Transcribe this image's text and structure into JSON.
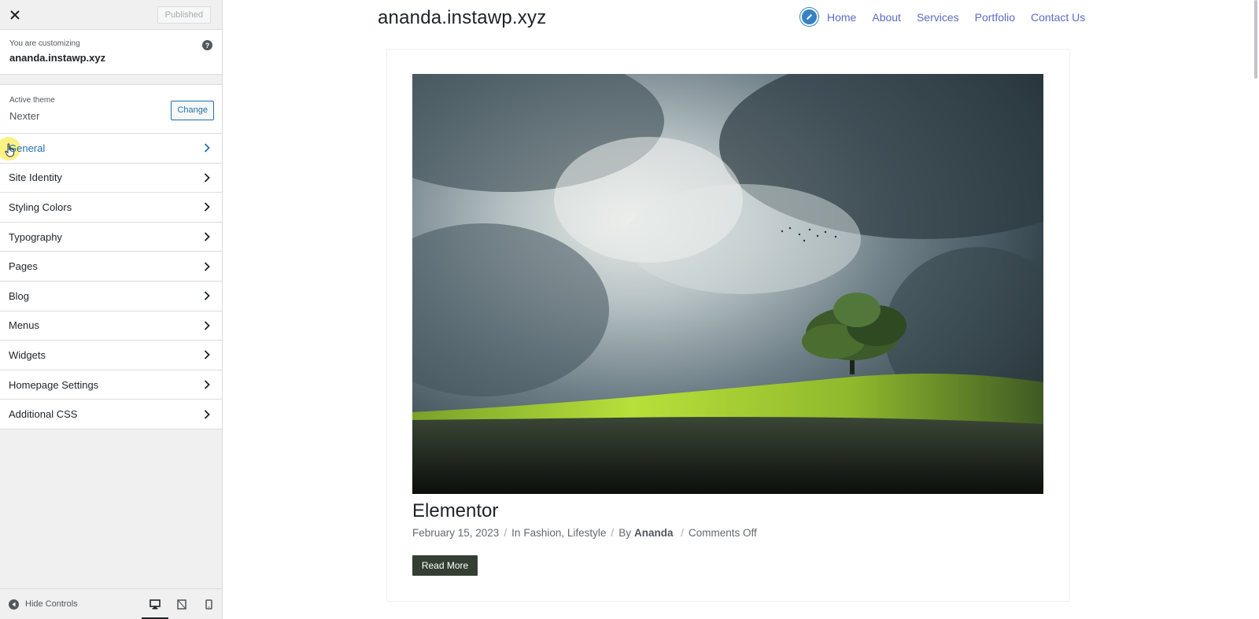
{
  "sidebar": {
    "published_label": "Published",
    "customizing_label": "You are customizing",
    "site_name": "ananda.instawp.xyz",
    "active_theme_label": "Active theme",
    "theme_name": "Nexter",
    "change_label": "Change",
    "items": [
      {
        "label": "General"
      },
      {
        "label": "Site Identity"
      },
      {
        "label": "Styling Colors"
      },
      {
        "label": "Typography"
      },
      {
        "label": "Pages"
      },
      {
        "label": "Blog"
      },
      {
        "label": "Menus"
      },
      {
        "label": "Widgets"
      },
      {
        "label": "Homepage Settings"
      },
      {
        "label": "Additional CSS"
      }
    ],
    "hide_controls_label": "Hide Controls"
  },
  "preview": {
    "site_title": "ananda.instawp.xyz",
    "nav": [
      "Home",
      "About",
      "Services",
      "Portfolio",
      "Contact Us"
    ],
    "post": {
      "title": "Elementor",
      "date": "February 15, 2023",
      "in_label": "In",
      "categories": "Fashion, Lifestyle",
      "by_label": "By",
      "author": "Ananda",
      "comments": "Comments Off",
      "read_more": "Read More"
    }
  },
  "colors": {
    "accent": "#2271b1",
    "nav_link": "#5b6bc4",
    "button_dark": "#333f33"
  }
}
